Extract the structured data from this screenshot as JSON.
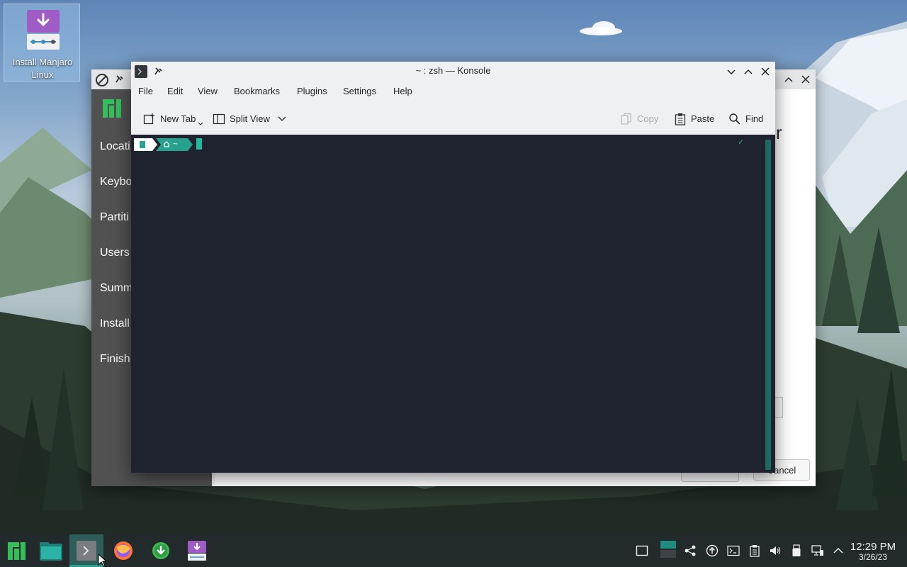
{
  "desktop": {
    "icon_label": "Install Manjaro Linux"
  },
  "installer": {
    "sidebar_items": [
      "Locati",
      "Keybo",
      "Partiti",
      "Users",
      "Summ",
      "Install",
      "Finish"
    ],
    "cancel_label": "Cancel",
    "peek_letter": "r"
  },
  "konsole": {
    "title": "~ : zsh — Konsole",
    "menu": [
      "File",
      "Edit",
      "View",
      "Bookmarks",
      "Plugins",
      "Settings",
      "Help"
    ],
    "toolbar": {
      "new_tab": "New Tab",
      "split_view": "Split View",
      "copy": "Copy",
      "paste": "Paste",
      "find": "Find"
    },
    "prompt": {
      "segment_path": "~",
      "status": "✓"
    }
  },
  "taskbar": {
    "apps": [
      "application-launcher",
      "file-manager",
      "konsole",
      "firefox",
      "software-center",
      "manjaro-installer"
    ],
    "clock_time": "12:29 PM",
    "clock_date": "3/26/23"
  },
  "colors": {
    "accent": "#27a28e",
    "terminal_bg": "#1f2330",
    "taskbar_bg": "#232a2b",
    "installer_sidebar": "#515151"
  }
}
